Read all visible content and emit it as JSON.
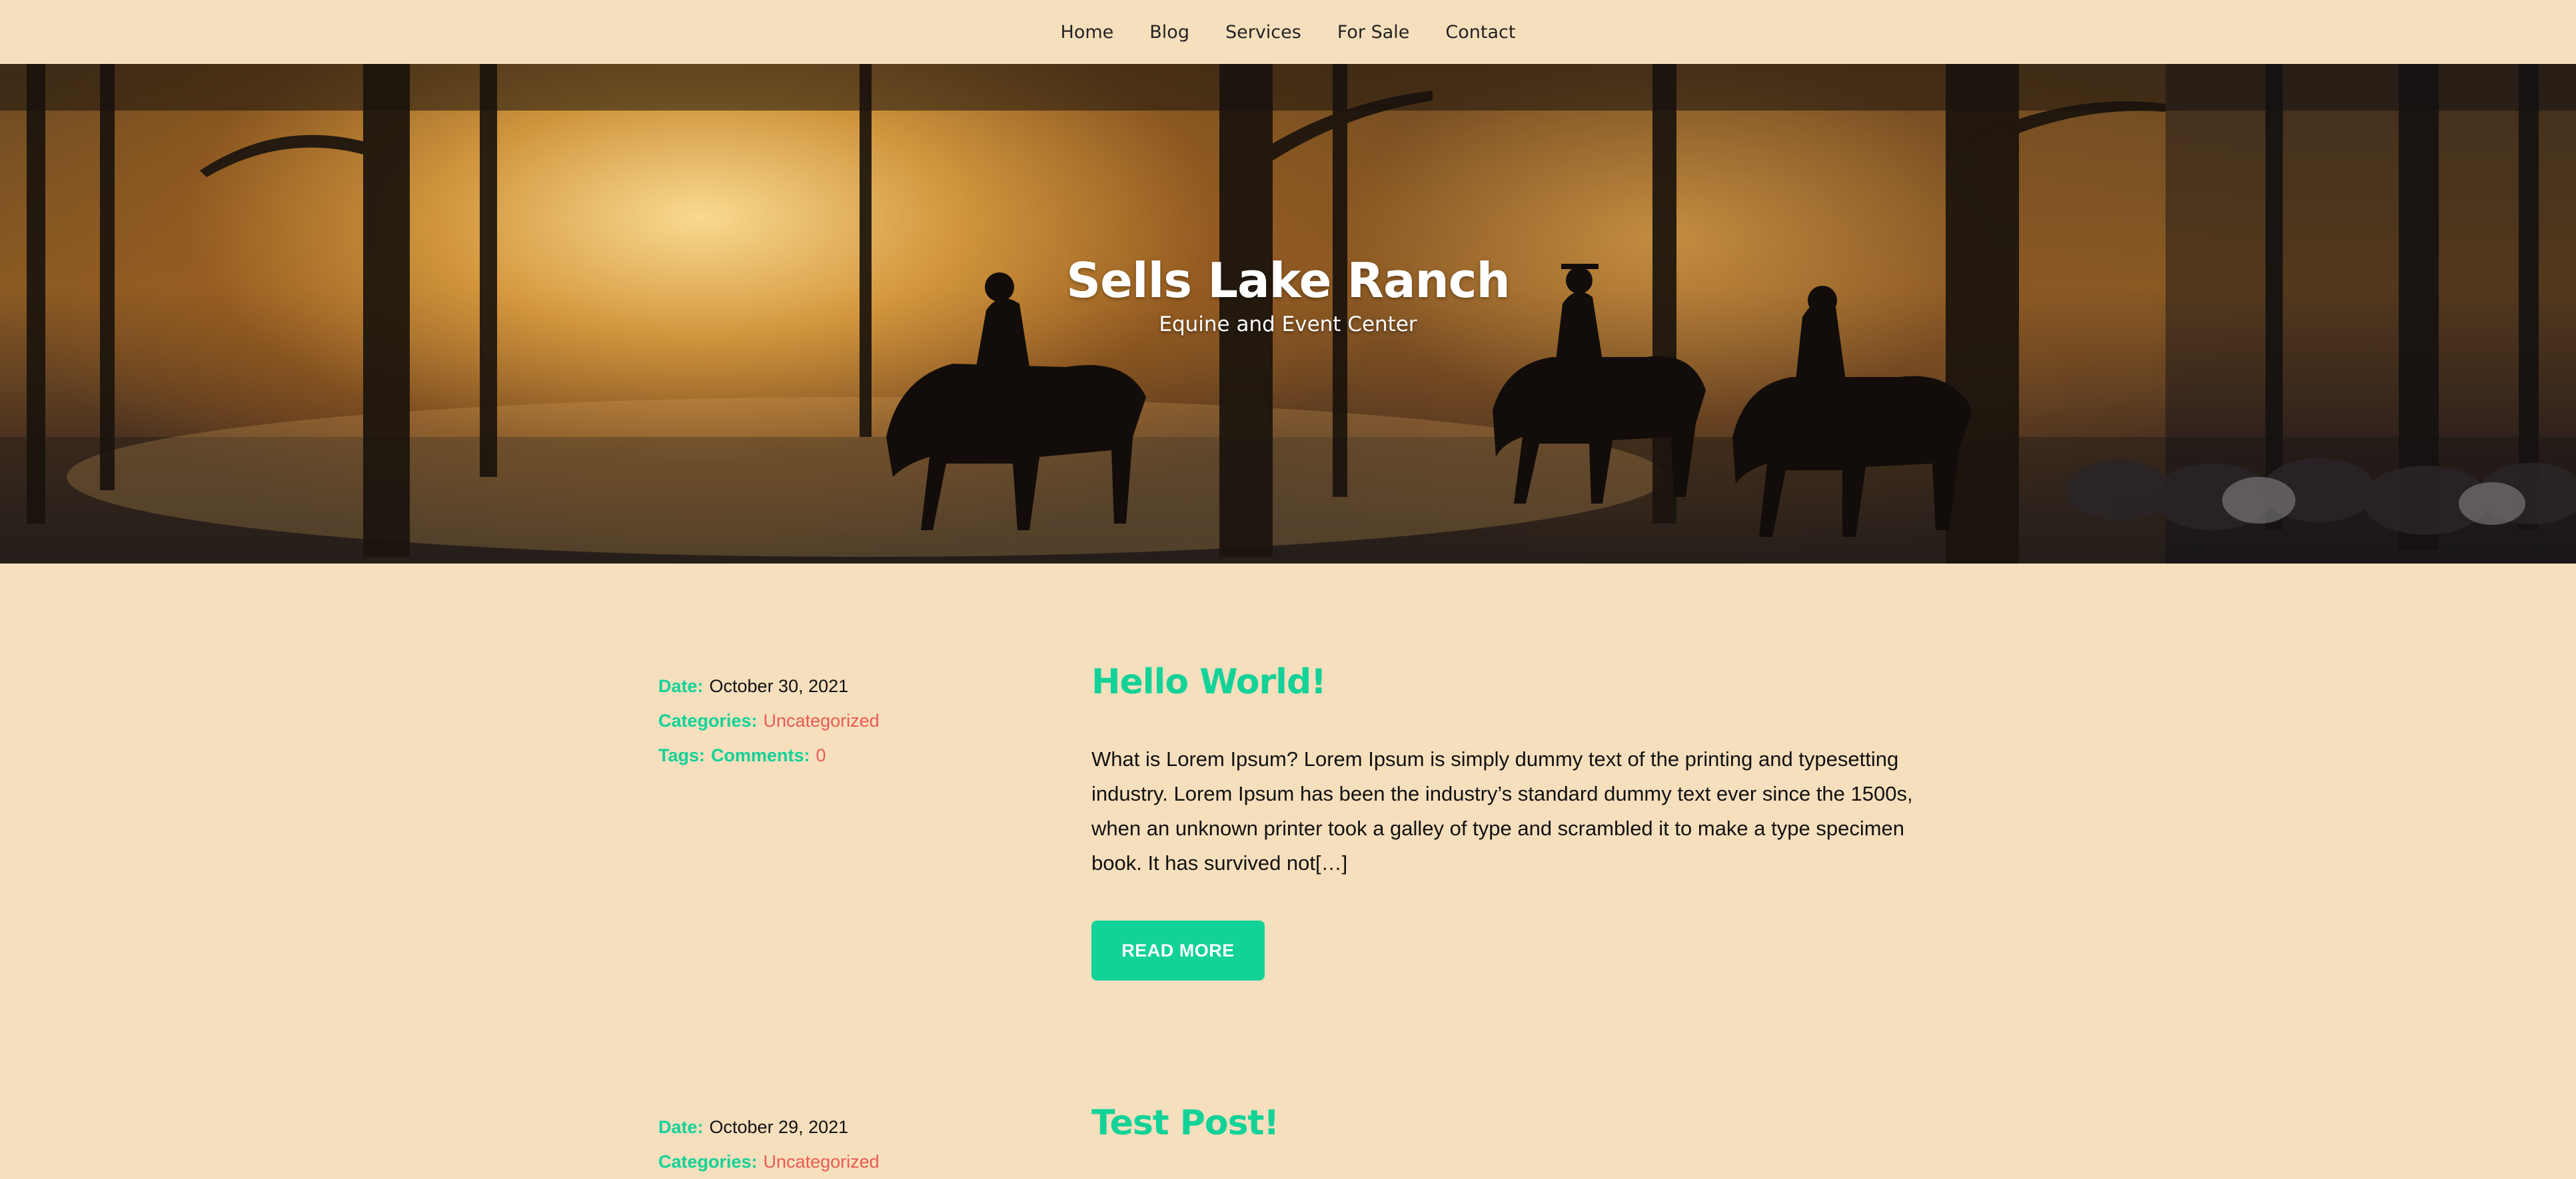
{
  "nav": {
    "items": [
      "Home",
      "Blog",
      "Services",
      "For Sale",
      "Contact"
    ]
  },
  "hero": {
    "title": "Sells Lake Ranch",
    "subtitle": "Equine and Event Center"
  },
  "labels": {
    "date": "Date:",
    "categories": "Categories:",
    "tags": "Tags:",
    "comments": "Comments:",
    "read_more": "READ MORE"
  },
  "posts": [
    {
      "title": "Hello World!",
      "date": "October 30, 2021",
      "category": "Uncategorized",
      "comments": "0",
      "excerpt": "What is Lorem Ipsum? Lorem Ipsum is simply dummy text of the printing and typesetting industry. Lorem Ipsum has been the industry’s standard dummy text ever since the 1500s, when an unknown printer took a galley of type and scrambled it to make a type specimen book. It has survived not[…]"
    },
    {
      "title": "Test Post!",
      "date": "October 29, 2021",
      "category": "Uncategorized"
    }
  ],
  "colors": {
    "background": "#f6dfbd",
    "accent": "#12d298",
    "link": "#ea5b52"
  }
}
